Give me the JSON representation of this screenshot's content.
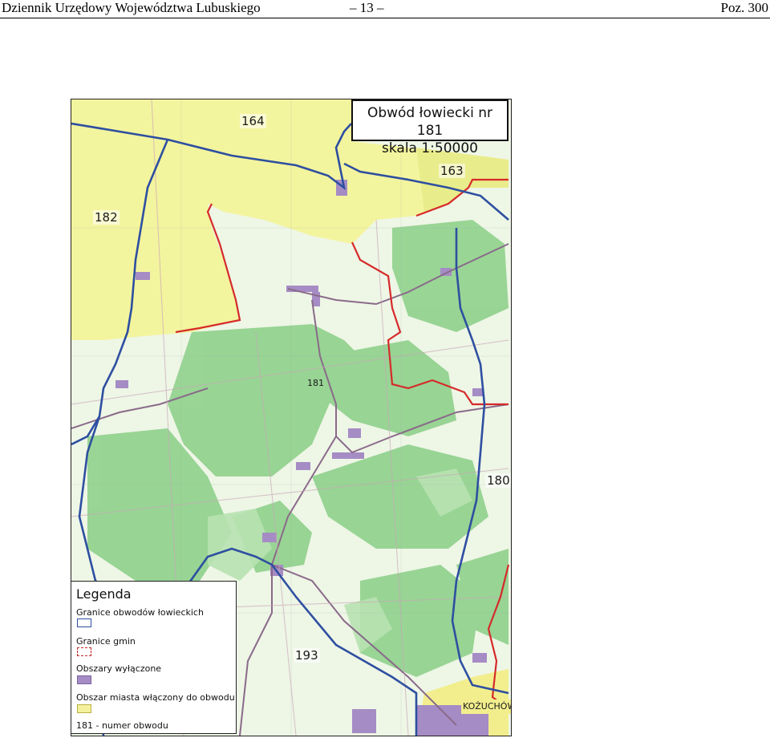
{
  "header": {
    "left": "Dziennik Urzędowy Województwa Lubuskiego",
    "center": "– 13 –",
    "right": "Poz. 300"
  },
  "map": {
    "title_line1": "Obwód łowiecki nr 181",
    "title_line2": "skala 1:50000",
    "district_labels": [
      "164",
      "163",
      "182",
      "181",
      "180",
      "193"
    ],
    "place_labels": [
      "KOŻUCHÓW"
    ],
    "colors": {
      "hunting_boundary": "#2e4fa0",
      "commune_boundary": "#c0282a",
      "excluded_area": "#a58cc4",
      "town_included": "#f4f19c",
      "forest": "#8ccf8a",
      "meadow": "#e9f3df"
    }
  },
  "legend": {
    "title": "Legenda",
    "items": [
      {
        "label": "Granice obwodów łowieckich",
        "swatch": "blue-outline"
      },
      {
        "label": "Granice gmin",
        "swatch": "red-dashed"
      },
      {
        "label": "Obszary wyłączone",
        "swatch": "purple-fill"
      },
      {
        "label": "Obszar miasta włączony do obwodu",
        "swatch": "yellow-fill"
      }
    ],
    "footnote": "181 - numer obwodu"
  }
}
